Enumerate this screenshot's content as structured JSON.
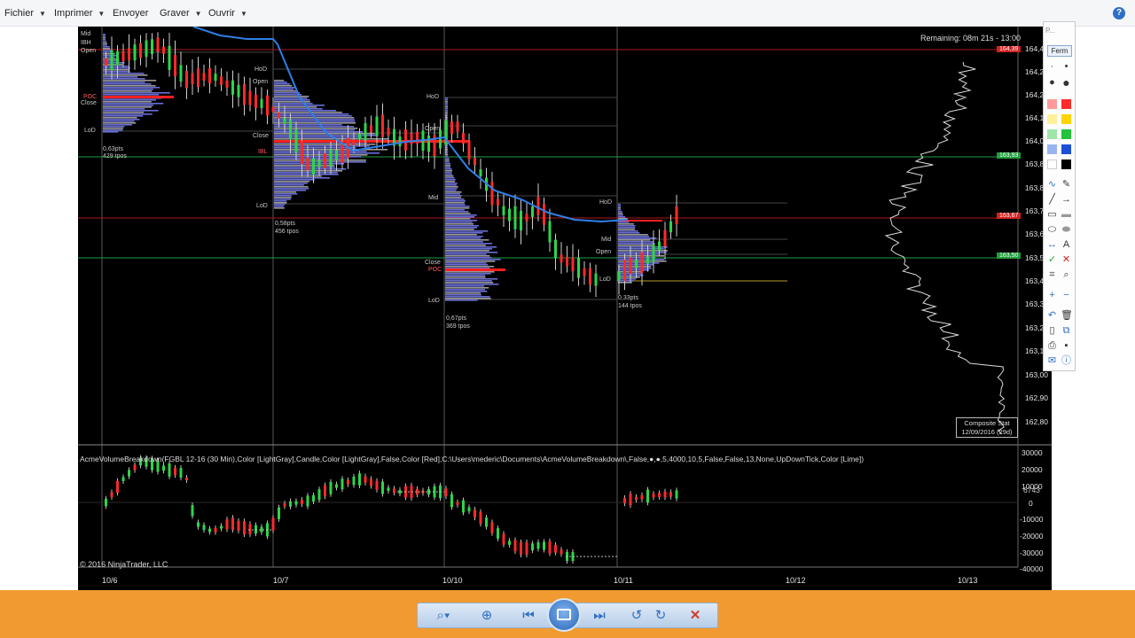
{
  "menubar": {
    "items": [
      {
        "label": "Fichier",
        "has_dropdown": true
      },
      {
        "label": "Imprimer",
        "has_dropdown": true
      },
      {
        "label": "Envoyer",
        "has_dropdown": false
      },
      {
        "label": "Graver",
        "has_dropdown": true
      },
      {
        "label": "Ouvrir",
        "has_dropdown": true
      }
    ],
    "help_icon": "help-icon"
  },
  "chart": {
    "remaining": "Remaining: 08m 21s - 13:00",
    "price_labels": [
      "164,4",
      "164,20",
      "164,1",
      "164,0",
      "163,8",
      "163,7",
      "163,6",
      "163,5",
      "163,4",
      "163,3",
      "163,2",
      "163,1",
      "163,00",
      "162,90",
      "162,80"
    ],
    "date_labels": [
      "10/6",
      "10/7",
      "10/10",
      "10/11",
      "10/12",
      "10/13"
    ],
    "price_markers": [
      {
        "text": "164,39",
        "color": "#d42020"
      },
      {
        "text": "163,93",
        "color": "#1e9e3a"
      },
      {
        "text": "163,67",
        "color": "#d42020"
      },
      {
        "text": "163,50",
        "color": "#1e9e3a"
      }
    ],
    "composite": {
      "line1": "Composite Stat",
      "line2": "12/09/2016 (29d)"
    },
    "indicator_text": "AcmeVolumeBreakdown(FGBL 12-16 (30 Min),Color [LightGray],Candle,Color [LightGray],False,Color [Red],C:\\Users\\mederic\\Documents\\AcmeVolumeBreakdown\\,False,●,●,5,4000,10,5,False,False,13,None,UpDownTick,Color [Lime])",
    "indicator_axis": [
      "30000",
      "20000",
      "10000",
      "0",
      "-10000",
      "-20000",
      "-30000",
      "-40000"
    ],
    "indicator_marker": "6743",
    "copyright": "© 2016 NinjaTrader, LLC",
    "profile_blocks": [
      {
        "labels": [
          "Mid",
          "IBH",
          "Open",
          "POC",
          "Close",
          "LoD"
        ],
        "stats": [
          "0,63pts",
          "429 tpos"
        ]
      },
      {
        "labels": [
          "HoD",
          "Open",
          "Close",
          "IBL",
          "LoD"
        ],
        "stats": [
          "0,58pts",
          "456 tpos"
        ]
      },
      {
        "labels": [
          "HoD",
          "Open",
          "Mid",
          "Close",
          "POC",
          "LoD"
        ],
        "stats": [
          "0,67pts",
          "369 tpos"
        ]
      },
      {
        "labels": [
          "HoD",
          "Mid",
          "Open",
          "LoD"
        ],
        "stats": [
          "0,33pts",
          "144 tpos"
        ]
      }
    ],
    "colors": {
      "up_candle": "#2cd64a",
      "down_candle": "#ff2a2a",
      "ma_line": "#2f7fe8",
      "profile": "#6a6fd6",
      "poc": "#ff2020"
    }
  },
  "palette": {
    "title": "P...",
    "close_label": "Ferm",
    "colors": [
      "#ff2a2a",
      "#ffd400",
      "#22c33a",
      "#1a4fd6",
      "#ffffff",
      "#000000"
    ]
  },
  "viewer_controls": {
    "buttons": [
      "zoom-icon",
      "fit-icon",
      "previous-icon",
      "slideshow-icon",
      "next-icon",
      "rotate-left-icon",
      "rotate-right-icon",
      "delete-icon"
    ]
  }
}
